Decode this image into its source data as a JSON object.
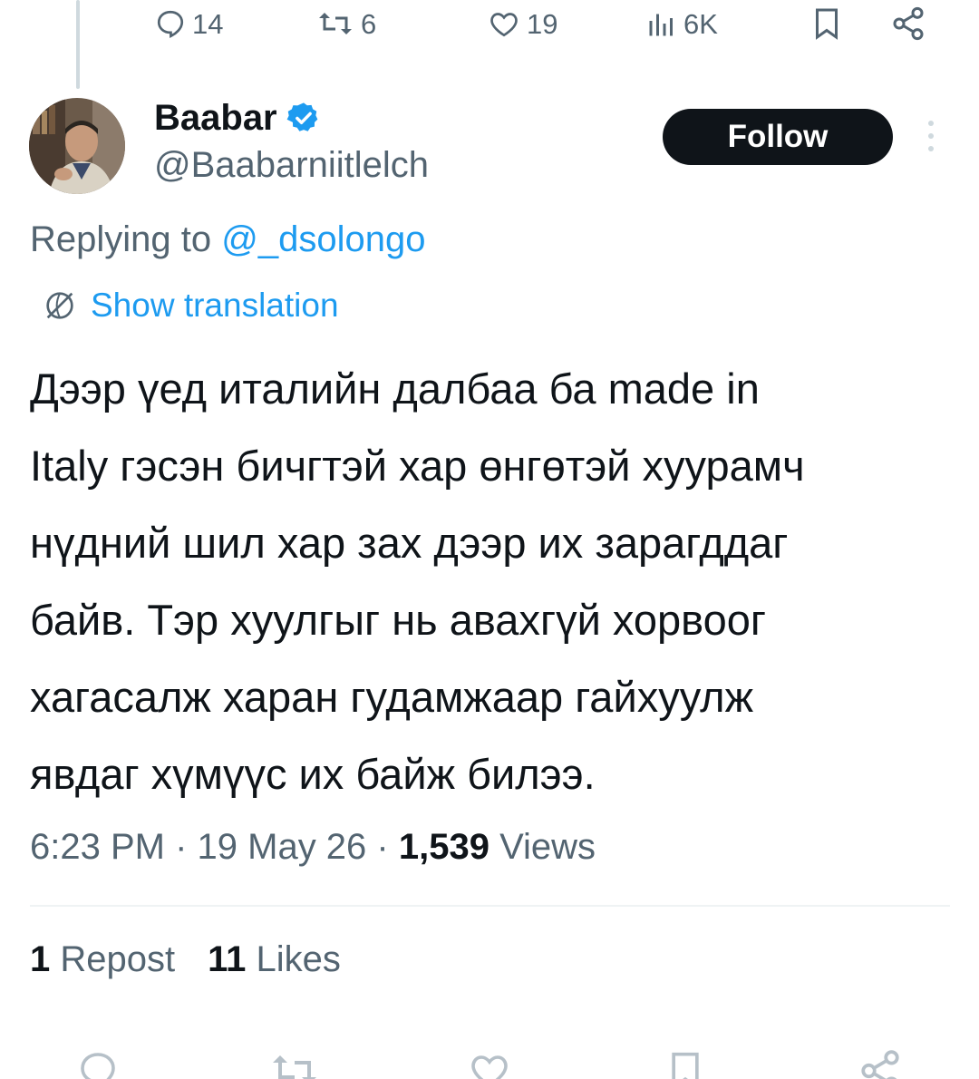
{
  "previous_tweet_actions": {
    "replies": "14",
    "reposts": "6",
    "likes": "19",
    "views": "6K"
  },
  "author": {
    "display_name": "Baabar",
    "handle": "@Baabarniitlelch",
    "verified": true,
    "verified_color": "#1d9bf0"
  },
  "follow_button": {
    "label": "Follow"
  },
  "replying": {
    "prefix": "Replying to ",
    "mention": "@_dsolongo"
  },
  "translation": {
    "label": "Show translation"
  },
  "tweet": {
    "lines": [
      "Дээр үед  италийн далбаа ба made in",
      "Italy гэсэн бичгтэй хар өнгөтэй хуурамч",
      "нүдний шил хар зах дээр их зарагддаг",
      "байв. Тэр хуулгыг нь авахгүй хорвоог",
      "хагасалж харан гудамжаар гайхуулж",
      "явдаг хүмүүс их байж билээ."
    ]
  },
  "meta": {
    "time": "6:23 PM",
    "sep1": " · ",
    "date": "19 May 26",
    "sep2": " · ",
    "views_count": "1,539",
    "views_label": " Views"
  },
  "stats": {
    "reposts_count": "1",
    "reposts_label": " Repost",
    "likes_count": "11",
    "likes_label": " Likes"
  },
  "colors": {
    "accent": "#1d9bf0",
    "text_primary": "#0f1419",
    "text_secondary": "#536471",
    "follow_bg": "#0f1419"
  },
  "icons": {
    "reply": "reply-icon",
    "repost": "repost-icon",
    "like": "heart-icon",
    "views": "views-icon",
    "bookmark": "bookmark-icon",
    "share": "share-icon",
    "more": "more-vertical-icon",
    "translate": "globe-icon",
    "verified": "verified-badge-icon"
  }
}
